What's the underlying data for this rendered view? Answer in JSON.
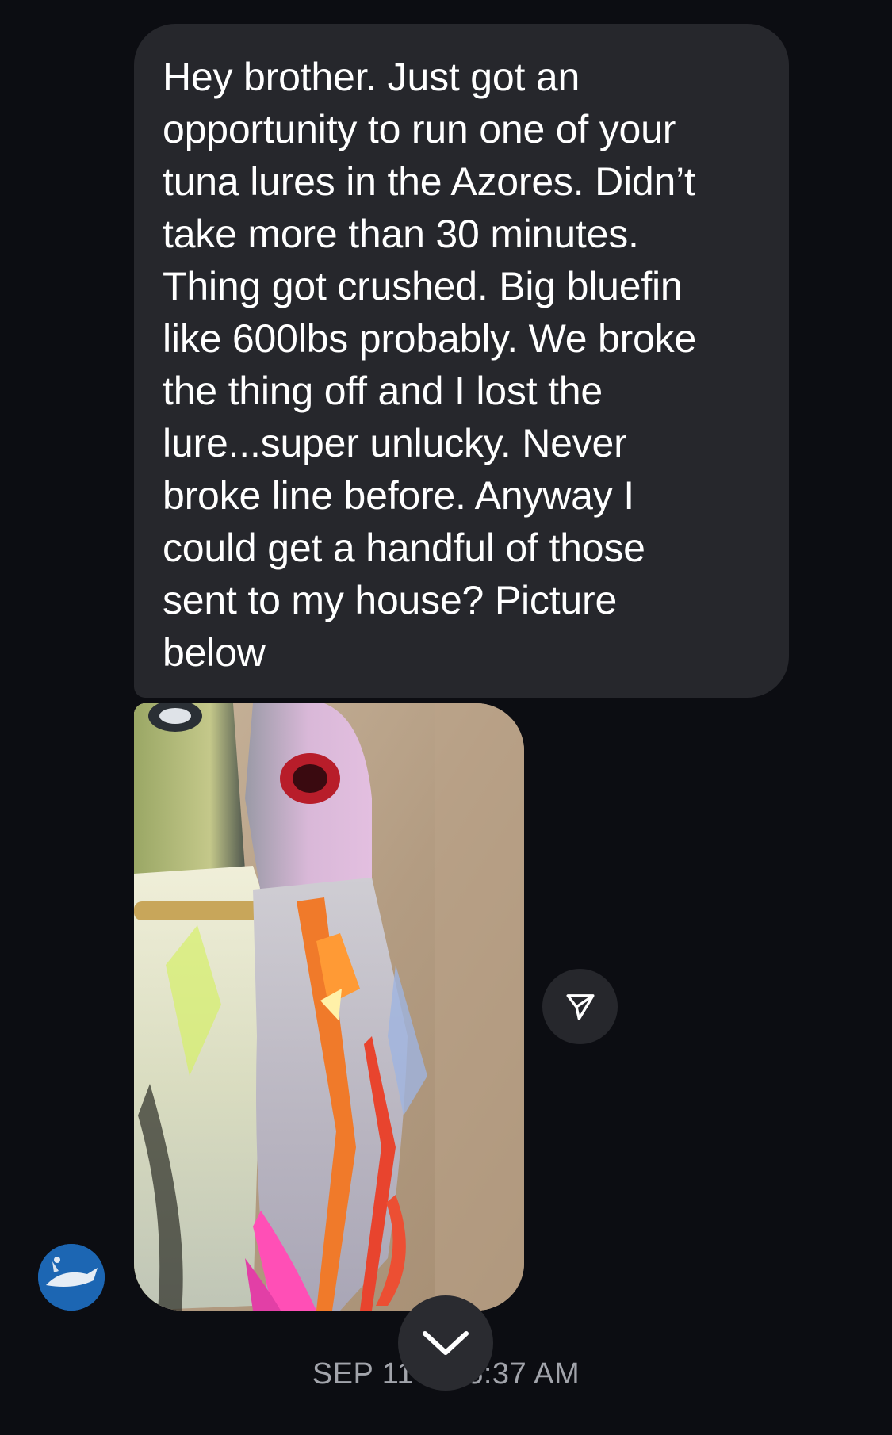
{
  "message": {
    "text": "Hey brother. Just got an\nopportunity to run one of your\ntuna lures in the Azores. Didn’t\ntake more than 30 minutes.\nThing got crushed. Big bluefin\nlike 600lbs probably. We broke\nthe thing off and I lost the\nlure...super unlucky. Never\nbroke line before. Anyway I\ncould get a handful of those\nsent to my house? Picture\nbelow"
  },
  "timestamp": "SEP 11 AT 5:37 AM",
  "colors": {
    "background": "#0c0d12",
    "bubble": "#26272c",
    "timestamp": "#a2a4ab",
    "avatar_bg": "#1a5ea8"
  },
  "icons": {
    "share": "paper-plane-icon",
    "scroll": "chevron-down-icon"
  }
}
